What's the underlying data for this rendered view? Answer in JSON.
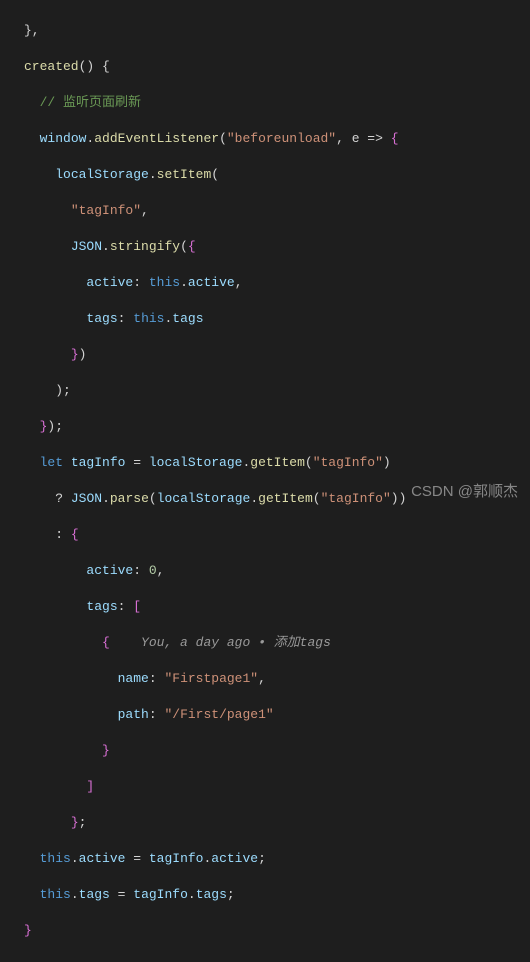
{
  "code": {
    "brace_close1": "},",
    "created_kw": "created",
    "created_tail": "() {",
    "comment_listen": "// 监听页面刷新",
    "window": "window",
    "dot": ".",
    "addEventListener": "addEventListener",
    "beforeunload": "\"beforeunload\"",
    "e_arrow": ", e => ",
    "lbrace": "{",
    "rbrace": "}",
    "lparen": "(",
    "rparen": ")",
    "lbracket": "[",
    "rbracket": "]",
    "semicolon": ";",
    "comma": ",",
    "localStorage": "localStorage",
    "setItem": "setItem",
    "getItem": "getItem",
    "tagInfoStr": "\"tagInfo\"",
    "JSON": "JSON",
    "stringify": "stringify",
    "parse": "parse",
    "active_key": "active",
    "tags_key": "tags",
    "this_kw": "this",
    "colon": ":",
    "space": " ",
    "active_prop": "active",
    "tags_prop": "tags",
    "let_kw": "let",
    "tagInfo_var": "tagInfo",
    "equals": " = ",
    "ternary_q": "?",
    "ternary_c": ":",
    "zero": "0",
    "gitlens": "You, a day ago • 添加tags",
    "name_key": "name",
    "path_key": "path",
    "firstpage": "\"Firstpage1\"",
    "firstpath": "\"/First/page1\"",
    "assign1_left": "active",
    "assign1_right": "active",
    "assign2_left": "tags",
    "assign2_right": "tags"
  },
  "watermark": "CSDN @郭顺杰"
}
